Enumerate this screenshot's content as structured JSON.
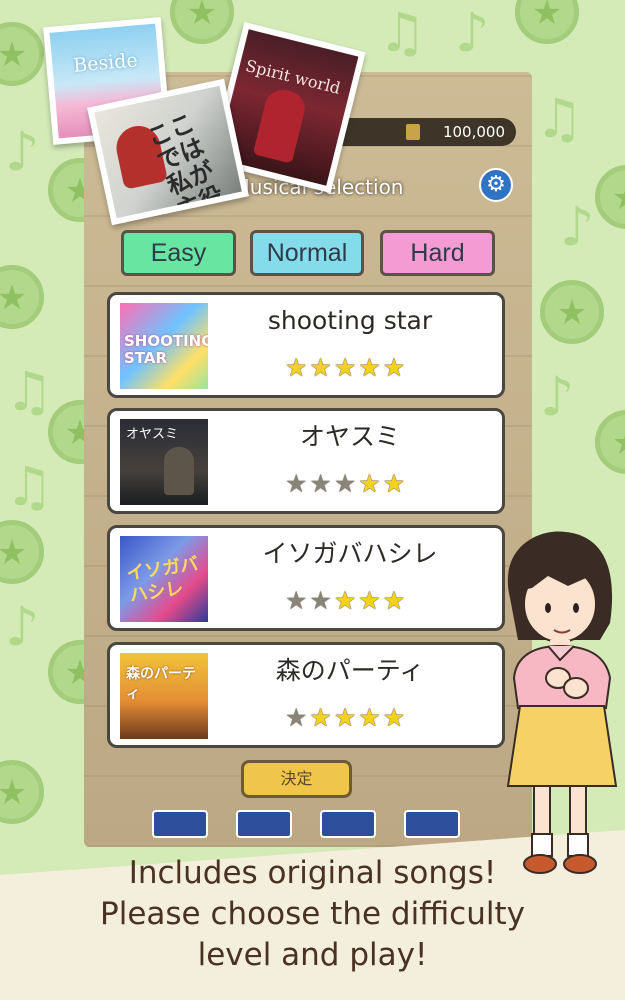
{
  "score": {
    "value": "100,000"
  },
  "header": {
    "title": "Musical selection",
    "settings_icon": "gear-icon"
  },
  "covers": [
    {
      "title": "Beside"
    },
    {
      "title": "Spirit world"
    },
    {
      "title": "ここでは私が主役"
    }
  ],
  "difficulty_tabs": [
    {
      "label": "Easy",
      "color": "#68e6a1"
    },
    {
      "label": "Normal",
      "color": "#84dbe9"
    },
    {
      "label": "Hard",
      "color": "#f59bd4"
    }
  ],
  "songs": [
    {
      "title": "shooting star",
      "thumb_text": "SHOOTING STAR",
      "stars_filled": 5,
      "stars_total": 5
    },
    {
      "title": "オヤスミ",
      "thumb_text": "オヤスミ",
      "stars_filled": 2,
      "stars_total": 5
    },
    {
      "title": "イソガバハシレ",
      "thumb_text": "イソガバハシレ",
      "stars_filled": 3,
      "stars_total": 5
    },
    {
      "title": "森のパーティ",
      "thumb_text": "森のパーティ",
      "stars_filled": 4,
      "stars_total": 5
    }
  ],
  "decide_button": {
    "label": "決定"
  },
  "caption": {
    "line1": "Includes original songs!",
    "line2": "Please choose the difficulty",
    "line3": "level and play!"
  },
  "colors": {
    "background": "#d4ebb8",
    "caption_text": "#4a3222",
    "star_on": "#f4d21a",
    "star_off": "#8a8478"
  }
}
